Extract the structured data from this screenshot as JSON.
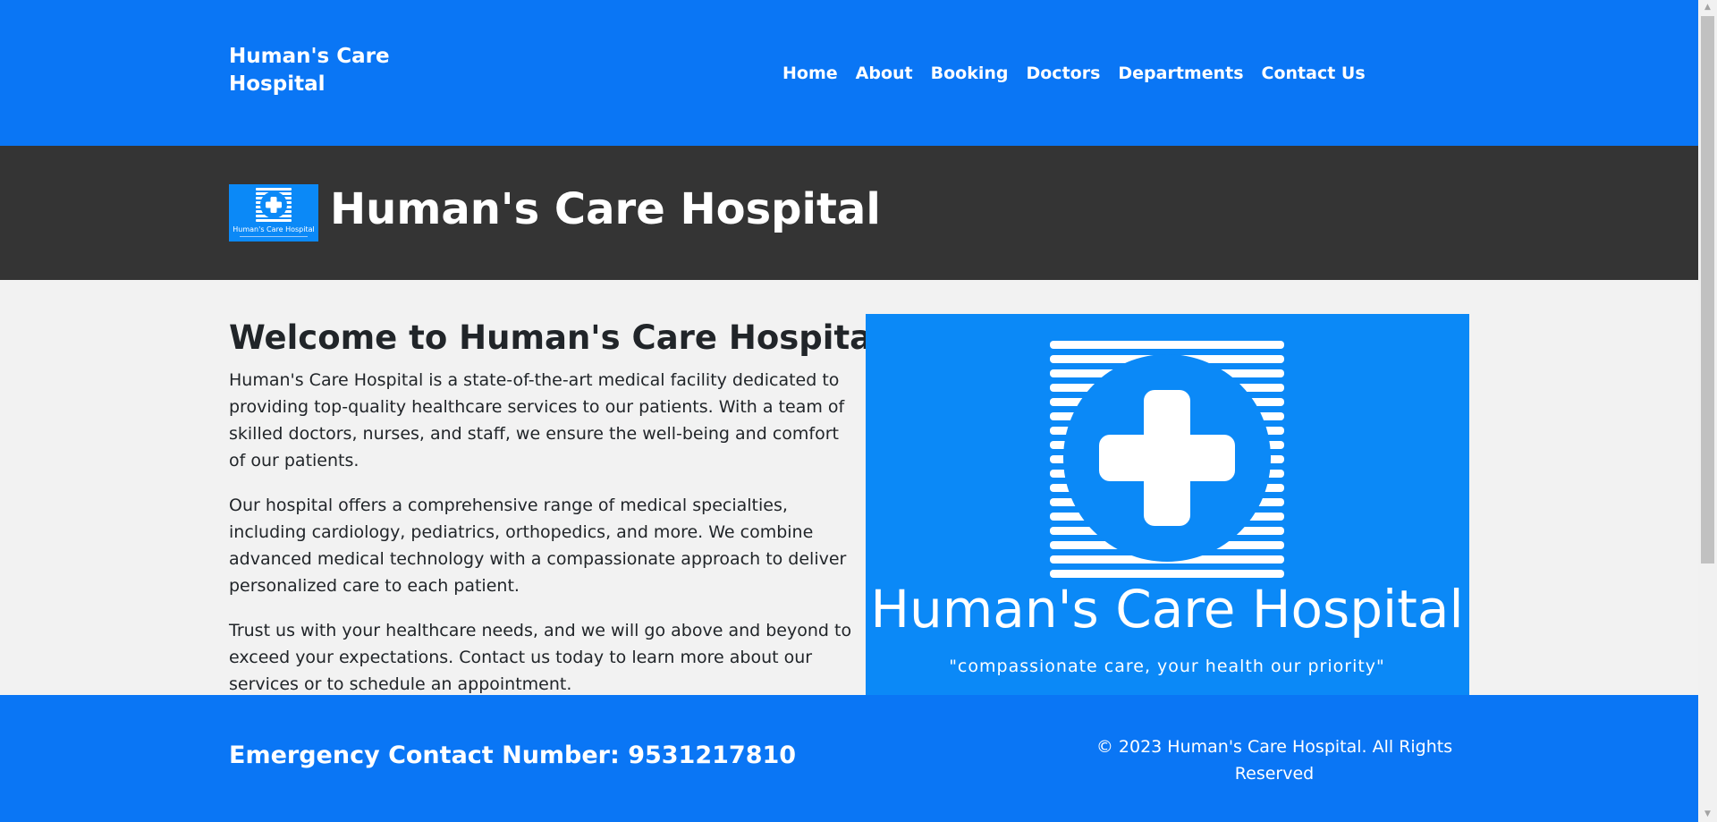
{
  "navbar": {
    "brand": "Human's Care Hospital",
    "links": [
      "Home",
      "About",
      "Booking",
      "Doctors",
      "Departments",
      "Contact Us"
    ]
  },
  "band": {
    "logo_text": "Human's Care Hospital",
    "title": "Human's Care Hospital"
  },
  "main": {
    "heading": "Welcome to Human's Care Hospital",
    "paragraphs": [
      "Human's Care Hospital is a state-of-the-art medical facility dedicated to providing top-quality healthcare services to our patients. With a team of skilled doctors, nurses, and staff, we ensure the well-being and comfort of our patients.",
      "Our hospital offers a comprehensive range of medical specialties, including cardiology, pediatrics, orthopedics, and more. We combine advanced medical technology with a compassionate approach to deliver personalized care to each patient.",
      "Trust us with your healthcare needs, and we will go above and beyond to exceed your expectations. Contact us today to learn more about our services or to schedule an appointment."
    ],
    "hero": {
      "name": "Human's Care Hospital",
      "tagline": "\"compassionate care, your health our priority\""
    }
  },
  "footer": {
    "emergency": "Emergency Contact Number: 9531217810",
    "copyright": "© 2023 Human's Care Hospital. All Rights Reserved"
  },
  "colors": {
    "primary": "#0a76f5",
    "logo_blue": "#0b89f7",
    "band": "#343434",
    "background": "#f2f2f2"
  }
}
